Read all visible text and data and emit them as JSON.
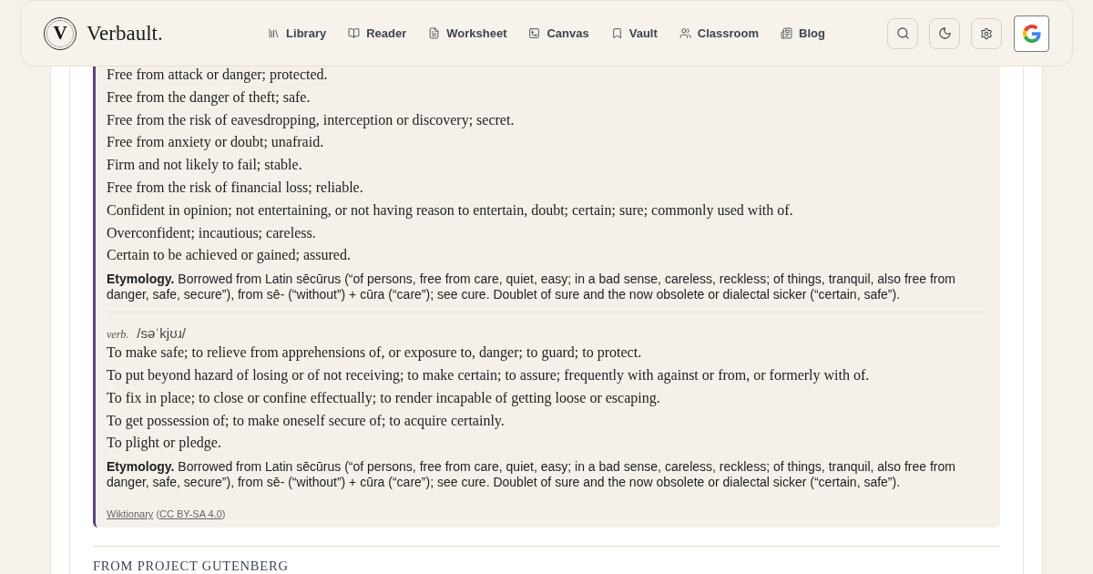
{
  "header": {
    "logo_letter": "V",
    "brand": "Verbault.",
    "nav": [
      {
        "label": "Library"
      },
      {
        "label": "Reader"
      },
      {
        "label": "Worksheet"
      },
      {
        "label": "Canvas"
      },
      {
        "label": "Vault"
      },
      {
        "label": "Classroom"
      },
      {
        "label": "Blog"
      }
    ]
  },
  "entry": {
    "senses": [
      {
        "definitions": [
          "Free from attack or danger; protected.",
          "Free from the danger of theft; safe.",
          "Free from the risk of eavesdropping, interception or discovery; secret.",
          "Free from anxiety or doubt; unafraid.",
          "Firm and not likely to fail; stable.",
          "Free from the risk of financial loss; reliable.",
          "Confident in opinion; not entertaining, or not having reason to entertain, doubt; certain; sure; commonly used with of.",
          "Overconfident; incautious; careless.",
          "Certain to be achieved or gained; assured."
        ],
        "etymology": "**Etymology.** Borrowed from Latin sēcūrus (“of persons, free from care, quiet, easy; in a bad sense, careless, reckless; of things, tranquil, also free from danger, safe, secure”), from sē- (“without”) + cūra (“care”); see cure. Doublet of sure and the now obsolete or dialectal sicker (“certain, safe”)."
      },
      {
        "part_of_speech": "verb.",
        "pronunciation": "/səˈkjʊɹ/",
        "definitions": [
          "To make safe; to relieve from apprehensions of, or exposure to, danger; to guard; to protect.",
          "To put beyond hazard of losing or of not receiving; to make certain; to assure; frequently with against or from, or formerly with of.",
          "To fix in place; to close or confine effectually; to render incapable of getting loose or escaping.",
          "To get possession of; to make oneself secure of; to acquire certainly.",
          "To plight or pledge."
        ],
        "etymology": "**Etymology.** Borrowed from Latin sēcūrus (“of persons, free from care, quiet, easy; in a bad sense, careless, reckless; of things, tranquil, also free from danger, safe, secure”), from sē- (“without”) + cūra (“care”); see cure. Doublet of sure and the now obsolete or dialectal sicker (“certain, safe”)."
      }
    ],
    "attribution": [
      {
        "kind": "link",
        "text": "Wiktionary"
      },
      {
        "kind": "text",
        "text": " ("
      },
      {
        "kind": "link",
        "text": "CC BY-SA 4.0"
      },
      {
        "kind": "text",
        "text": ")"
      }
    ]
  },
  "next_section": {
    "heading": "FROM PROJECT GUTENBERG"
  }
}
